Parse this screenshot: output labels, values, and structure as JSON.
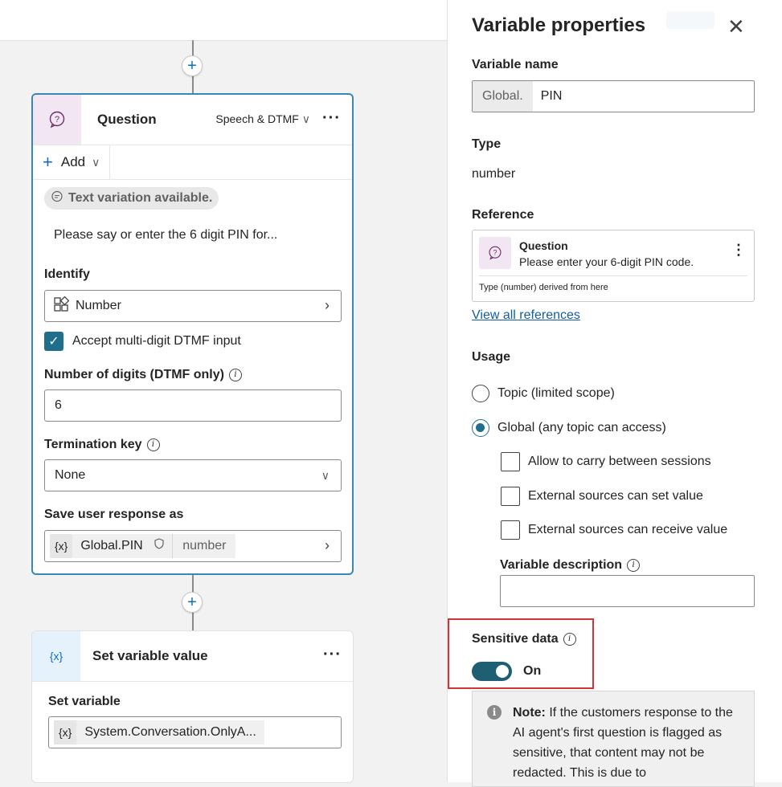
{
  "canvas": {
    "question_node": {
      "title": "Question",
      "mode": "Speech & DTMF",
      "more": "···",
      "add_label": "Add",
      "chip": "Text variation available.",
      "prompt": "Please say or enter the 6 digit PIN for...",
      "identify_label": "Identify",
      "identify_value": "Number",
      "accept_label": "Accept multi-digit DTMF input",
      "digits_label": "Number of digits (DTMF only)",
      "digits_value": "6",
      "termination_label": "Termination key",
      "termination_value": "None",
      "save_label": "Save user response as",
      "save_var_icon": "{x}",
      "save_var_name": "Global.PIN",
      "save_var_type": "number"
    },
    "set_node": {
      "icon": "{x}",
      "title": "Set variable value",
      "more": "···",
      "set_label": "Set variable",
      "var_icon": "{x}",
      "var_value": "System.Conversation.OnlyA..."
    }
  },
  "panel": {
    "title": "Variable properties",
    "close": "✕",
    "name_label": "Variable name",
    "name_prefix": "Global.",
    "name_value": "PIN",
    "type_label": "Type",
    "type_value": "number",
    "reference_label": "Reference",
    "reference": {
      "title": "Question",
      "subtitle": "Please enter your 6-digit PIN code.",
      "footer": "Type (number) derived from here"
    },
    "view_all": "View all references",
    "usage_label": "Usage",
    "usage_options": [
      {
        "label": "Topic (limited scope)",
        "selected": false
      },
      {
        "label": "Global (any topic can access)",
        "selected": true
      }
    ],
    "global_options": [
      "Allow to carry between sessions",
      "External sources can set value",
      "External sources can receive value"
    ],
    "description_label": "Variable description",
    "sensitive_label": "Sensitive data",
    "sensitive_state": "On",
    "note_bold": "Note:",
    "note_text": " If the customers response to the AI agent's first question is flagged as sensitive, that content may not be redacted. This is due to"
  },
  "colors": {
    "accent": "#1f6e8c",
    "highlight": "#d13438",
    "link": "#115ea3"
  }
}
